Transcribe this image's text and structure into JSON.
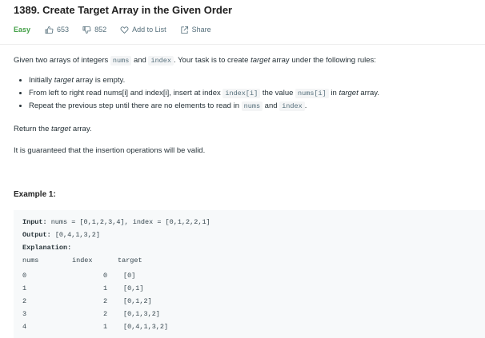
{
  "problem": {
    "title": "1389. Create Target Array in the Given Order",
    "difficulty": "Easy",
    "likes": "653",
    "dislikes": "852",
    "add_to_list": "Add to List",
    "share": "Share"
  },
  "description": {
    "intro": {
      "t1": "Given two arrays of integers ",
      "c1": "nums",
      "t2": " and ",
      "c2": "index",
      "t3": ". Your task is to create ",
      "e1": "target",
      "t4": " array under the following rules:"
    },
    "rules": [
      {
        "t1": "Initially ",
        "e1": "target",
        "t2": " array is empty."
      },
      {
        "t1": "From left to right read nums[i] and index[i], insert at index ",
        "c1": "index[i]",
        "t2": " the value ",
        "c2": "nums[i]",
        "t3": " in ",
        "e1": "target",
        "t4": " array."
      },
      {
        "t1": "Repeat the previous step until there are no elements to read in ",
        "c1": "nums",
        "t2": " and ",
        "c2": "index",
        "t3": "."
      }
    ],
    "return_text": {
      "t1": "Return the ",
      "e1": "target",
      "t2": " array."
    },
    "guarantee": "It is guaranteed that the insertion operations will be valid."
  },
  "example": {
    "heading": "Example 1:",
    "input_label": "Input:",
    "input_value": " nums = [0,1,2,3,4], index = [0,1,2,2,1]",
    "output_label": "Output:",
    "output_value": " [0,4,1,3,2]",
    "explanation_label": "Explanation:",
    "table": {
      "headers": [
        "nums",
        "index",
        "target"
      ],
      "rows": [
        [
          "0",
          "0",
          "[0]"
        ],
        [
          "1",
          "1",
          "[0,1]"
        ],
        [
          "2",
          "2",
          "[0,1,2]"
        ],
        [
          "3",
          "2",
          "[0,1,3,2]"
        ],
        [
          "4",
          "1",
          "[0,4,1,3,2]"
        ]
      ]
    }
  },
  "colors": {
    "easy": "#43a047",
    "code_bg": "#f4f5f6",
    "example_bg": "#f7f9fa"
  }
}
